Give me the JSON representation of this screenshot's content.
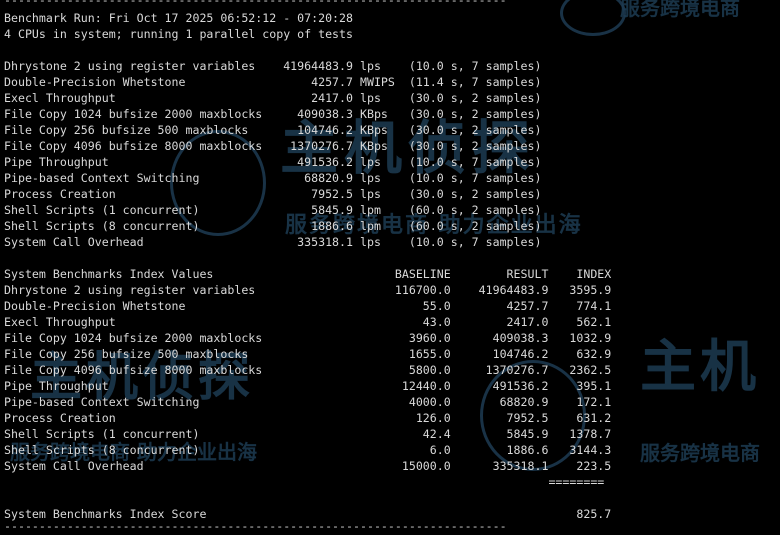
{
  "terminal": {
    "separator": "------------------------------------------------------------------------",
    "header_line": "Benchmark Run: Fri Oct 17 2025 06:52:12 - 07:20:28",
    "cpu_line": "4 CPUs in system; running 1 parallel copy of tests",
    "results": [
      {
        "test": "Dhrystone 2 using register variables",
        "value": "41964483.9",
        "unit": "lps",
        "detail": "(10.0 s, 7 samples)"
      },
      {
        "test": "Double-Precision Whetstone",
        "value": "4257.7",
        "unit": "MWIPS",
        "detail": "(11.4 s, 7 samples)"
      },
      {
        "test": "Execl Throughput",
        "value": "2417.0",
        "unit": "lps",
        "detail": "(30.0 s, 2 samples)"
      },
      {
        "test": "File Copy 1024 bufsize 2000 maxblocks",
        "value": "409038.3",
        "unit": "KBps",
        "detail": "(30.0 s, 2 samples)"
      },
      {
        "test": "File Copy 256 bufsize 500 maxblocks",
        "value": "104746.2",
        "unit": "KBps",
        "detail": "(30.0 s, 2 samples)"
      },
      {
        "test": "File Copy 4096 bufsize 8000 maxblocks",
        "value": "1370276.7",
        "unit": "KBps",
        "detail": "(30.0 s, 2 samples)"
      },
      {
        "test": "Pipe Throughput",
        "value": "491536.2",
        "unit": "lps",
        "detail": "(10.0 s, 7 samples)"
      },
      {
        "test": "Pipe-based Context Switching",
        "value": "68820.9",
        "unit": "lps",
        "detail": "(10.0 s, 7 samples)"
      },
      {
        "test": "Process Creation",
        "value": "7952.5",
        "unit": "lps",
        "detail": "(30.0 s, 2 samples)"
      },
      {
        "test": "Shell Scripts (1 concurrent)",
        "value": "5845.9",
        "unit": "lpm",
        "detail": "(60.0 s, 2 samples)"
      },
      {
        "test": "Shell Scripts (8 concurrent)",
        "value": "1886.6",
        "unit": "lpm",
        "detail": "(60.0 s, 2 samples)"
      },
      {
        "test": "System Call Overhead",
        "value": "335318.1",
        "unit": "lps",
        "detail": "(10.0 s, 7 samples)"
      }
    ],
    "index_header": {
      "title": "System Benchmarks Index Values",
      "baseline": "BASELINE",
      "result": "RESULT",
      "index": "INDEX"
    },
    "index_rows": [
      {
        "test": "Dhrystone 2 using register variables",
        "baseline": "116700.0",
        "result": "41964483.9",
        "index": "3595.9"
      },
      {
        "test": "Double-Precision Whetstone",
        "baseline": "55.0",
        "result": "4257.7",
        "index": "774.1"
      },
      {
        "test": "Execl Throughput",
        "baseline": "43.0",
        "result": "2417.0",
        "index": "562.1"
      },
      {
        "test": "File Copy 1024 bufsize 2000 maxblocks",
        "baseline": "3960.0",
        "result": "409038.3",
        "index": "1032.9"
      },
      {
        "test": "File Copy 256 bufsize 500 maxblocks",
        "baseline": "1655.0",
        "result": "104746.2",
        "index": "632.9"
      },
      {
        "test": "File Copy 4096 bufsize 8000 maxblocks",
        "baseline": "5800.0",
        "result": "1370276.7",
        "index": "2362.5"
      },
      {
        "test": "Pipe Throughput",
        "baseline": "12440.0",
        "result": "491536.2",
        "index": "395.1"
      },
      {
        "test": "Pipe-based Context Switching",
        "baseline": "4000.0",
        "result": "68820.9",
        "index": "172.1"
      },
      {
        "test": "Process Creation",
        "baseline": "126.0",
        "result": "7952.5",
        "index": "631.2"
      },
      {
        "test": "Shell Scripts (1 concurrent)",
        "baseline": "42.4",
        "result": "5845.9",
        "index": "1378.7"
      },
      {
        "test": "Shell Scripts (8 concurrent)",
        "baseline": "6.0",
        "result": "1886.6",
        "index": "3144.3"
      },
      {
        "test": "System Call Overhead",
        "baseline": "15000.0",
        "result": "335318.1",
        "index": "223.5"
      }
    ],
    "score_rule": "========",
    "score": {
      "label": "System Benchmarks Index Score",
      "value": "825.7"
    }
  },
  "watermarks": {
    "brand_cn": "主机",
    "brand_cn_full": "主机侦探",
    "slogan_a": "服务跨境电商",
    "slogan_b": "服务跨境电商 助力企业出海",
    "slogan_c": "服务跨境电商",
    "slogan_d": "服务跨境电商 助力企业出海",
    "brand_d": "主机侦探"
  }
}
